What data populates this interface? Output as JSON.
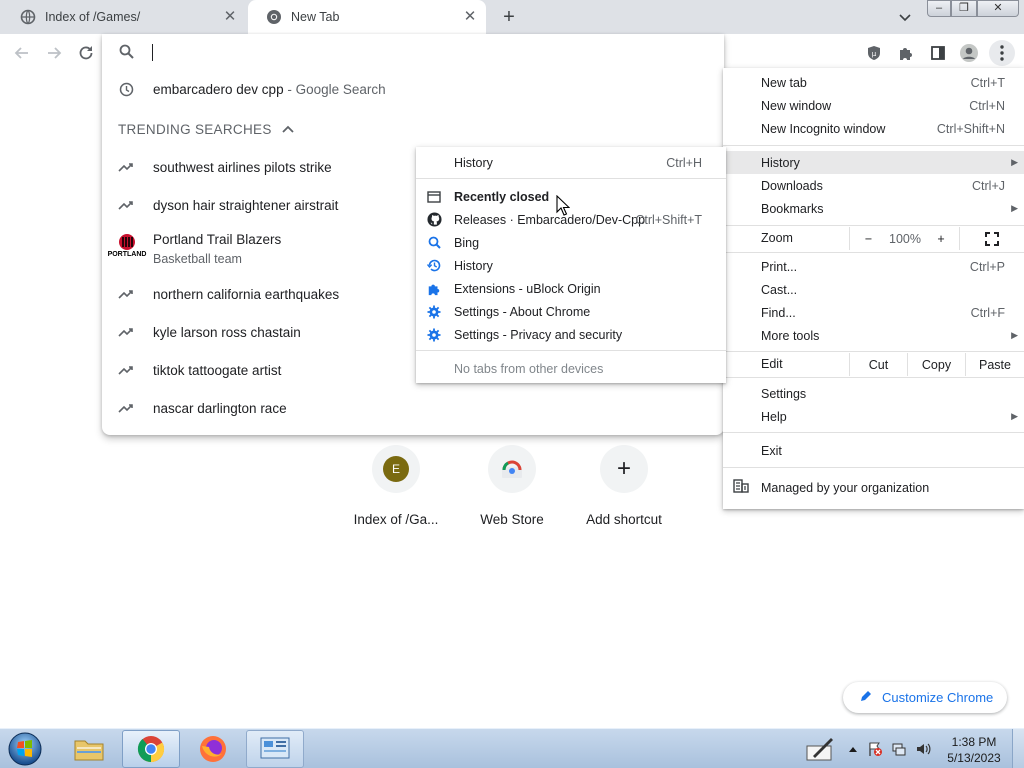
{
  "tabs": [
    {
      "title": "Index of /Games/",
      "icon": "globe-icon"
    },
    {
      "title": "New Tab",
      "icon": "chrome-icon"
    }
  ],
  "window_controls": {
    "minimize": "‒",
    "maximize": "❐",
    "close": "✕"
  },
  "omnibox": {
    "history_suggestion": {
      "text": "embarcadero dev cpp",
      "suffix": " - Google Search"
    },
    "trending_header": "TRENDING SEARCHES",
    "trending": [
      "southwest airlines pilots strike",
      "dyson hair straightener airstrait",
      "northern california earthquakes",
      "kyle larson ross chastain",
      "tiktok tattoogate artist",
      "nascar darlington race"
    ],
    "entity": {
      "title": "Portland Trail Blazers",
      "subtitle": "Basketball team",
      "logo_text": "PORTLAND"
    }
  },
  "chrome_menu": {
    "new_tab": {
      "label": "New tab",
      "shortcut": "Ctrl+T"
    },
    "new_window": {
      "label": "New window",
      "shortcut": "Ctrl+N"
    },
    "new_incognito": {
      "label": "New Incognito window",
      "shortcut": "Ctrl+Shift+N"
    },
    "history": {
      "label": "History"
    },
    "downloads": {
      "label": "Downloads",
      "shortcut": "Ctrl+J"
    },
    "bookmarks": {
      "label": "Bookmarks"
    },
    "zoom": {
      "label": "Zoom",
      "minus": "−",
      "value": "100%",
      "plus": "+"
    },
    "print": {
      "label": "Print...",
      "shortcut": "Ctrl+P"
    },
    "cast": {
      "label": "Cast..."
    },
    "find": {
      "label": "Find...",
      "shortcut": "Ctrl+F"
    },
    "more_tools": {
      "label": "More tools"
    },
    "edit": {
      "label": "Edit",
      "cut": "Cut",
      "copy": "Copy",
      "paste": "Paste"
    },
    "settings": {
      "label": "Settings"
    },
    "help": {
      "label": "Help"
    },
    "exit": {
      "label": "Exit"
    },
    "managed": {
      "label": "Managed by your organization"
    }
  },
  "history_submenu": {
    "history": {
      "label": "History",
      "shortcut": "Ctrl+H"
    },
    "recently_closed": "Recently closed",
    "items": [
      {
        "label": "Releases · Embarcadero/Dev-Cpp",
        "shortcut": "Ctrl+Shift+T",
        "icon": "github-icon"
      },
      {
        "label": "Bing",
        "icon": "search-icon"
      },
      {
        "label": "History",
        "icon": "history-icon"
      },
      {
        "label": "Extensions - uBlock Origin",
        "icon": "puzzle-icon"
      },
      {
        "label": "Settings - About Chrome",
        "icon": "gear-icon"
      },
      {
        "label": "Settings - Privacy and security",
        "icon": "gear-icon"
      }
    ],
    "no_tabs": "No tabs from other devices"
  },
  "shortcuts": [
    {
      "label": "Index of /Ga...",
      "letter": "E"
    },
    {
      "label": "Web Store"
    },
    {
      "label": "Add shortcut",
      "glyph": "+"
    }
  ],
  "customize": {
    "label": "Customize Chrome"
  },
  "clock": {
    "time": "1:38 PM",
    "date": "5/13/2023"
  },
  "colors": {
    "accent": "#1a73e8",
    "tab_strip": "#dee1e6",
    "menu_highlight": "#e8e8e9",
    "avatar_olive": "#7a6a10"
  }
}
